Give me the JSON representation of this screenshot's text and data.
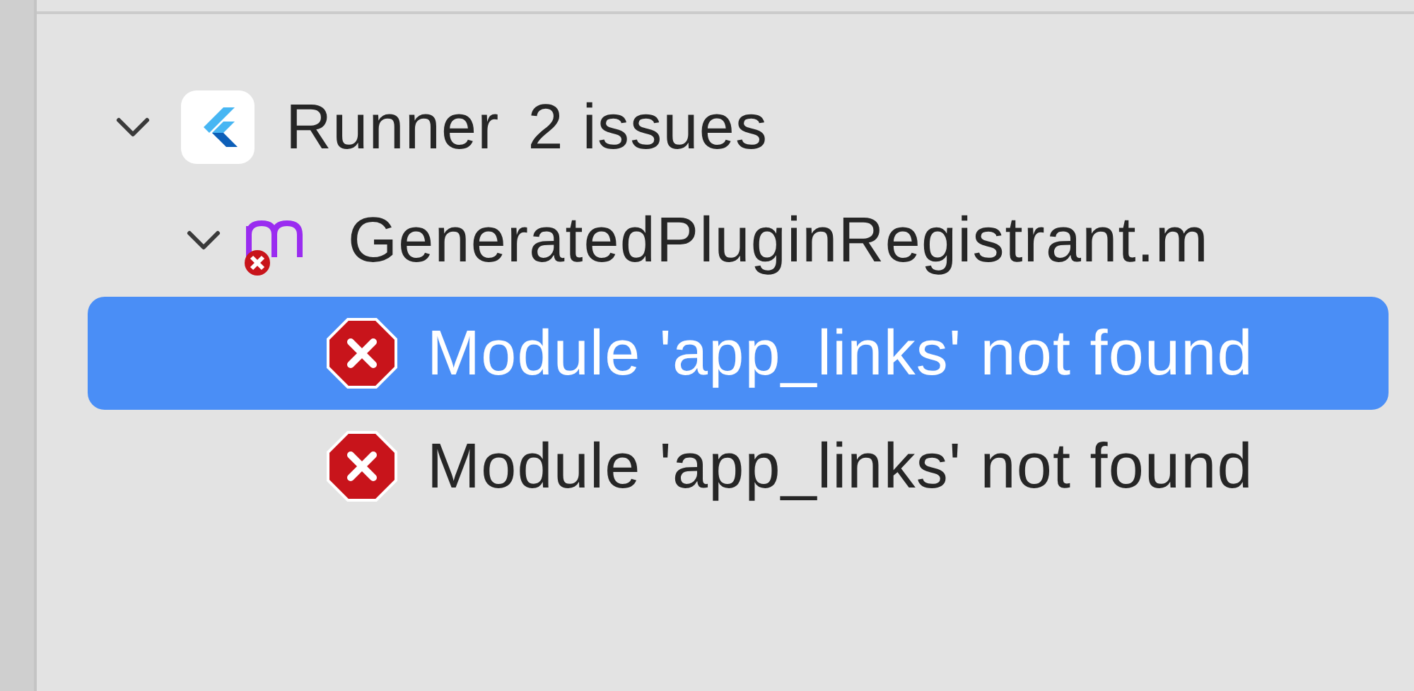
{
  "issue_tree": [
    {
      "kind": "project",
      "name": "Runner",
      "count": "2 issues",
      "expanded": true,
      "children": [
        {
          "kind": "objc-file",
          "name": "GeneratedPluginRegistrant.m",
          "expanded": true,
          "children": [
            {
              "kind": "error",
              "message": "Module 'app_links' not found",
              "selected": true
            },
            {
              "kind": "error",
              "message": "Module 'app_links' not found",
              "selected": false
            }
          ]
        }
      ]
    }
  ]
}
